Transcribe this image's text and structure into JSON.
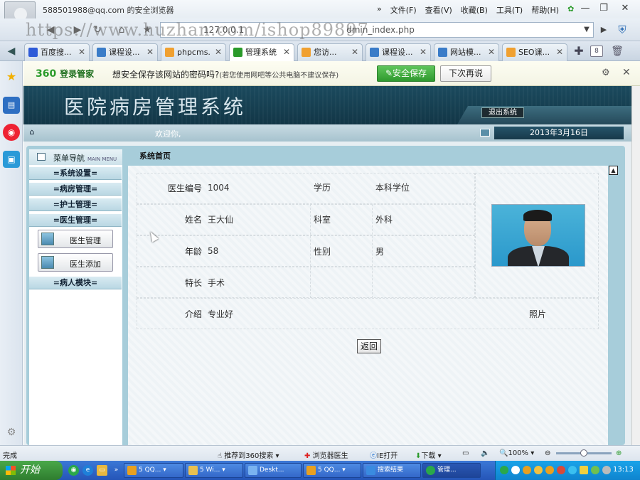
{
  "browser": {
    "title": "588501988@qq.com 的安全浏览器",
    "menu": [
      "文件(F)",
      "查看(V)",
      "收藏(B)",
      "工具(T)",
      "帮助(H)"
    ],
    "window_controls": [
      "—",
      "❐",
      "✕"
    ],
    "address": "127.0.0.1",
    "watermark": "https://www.huzhan.com/ishop89897",
    "address_path": "dmin_index.php",
    "tabs": [
      {
        "label": "百度搜...",
        "active": false
      },
      {
        "label": "课程设...",
        "active": false
      },
      {
        "label": "phpcms...",
        "active": false
      },
      {
        "label": "管理系统",
        "active": true
      },
      {
        "label": "您访...",
        "active": false
      },
      {
        "label": "课程设...",
        "active": false
      },
      {
        "label": "网站模...",
        "active": false
      },
      {
        "label": "SEO课...",
        "active": false
      }
    ],
    "tab_count": "8"
  },
  "password_bar": {
    "logo": "360",
    "logo_sub": "登录管家",
    "message": "想安全保存该网站的密码吗?",
    "hint": "(若您使用网吧等公共电脑不建议保存)",
    "save_label": "安全保存",
    "later_label": "下次再说"
  },
  "page": {
    "system_title": "医院病房管理系统",
    "logout_label": "退出系统",
    "welcome": "欢迎你,",
    "date": "2013年3月16日",
    "menu_title": "菜单导航",
    "menu_title_en": "MAIN MENU",
    "menu": [
      "=系统设置=",
      "=病房管理=",
      "=护士管理=",
      "=医生管理=",
      "=病人模块="
    ],
    "submenu": [
      "医生管理",
      "医生添加"
    ],
    "content_title": "系统首页",
    "detail": {
      "doctor_id_label": "医生编号",
      "doctor_id": "1004",
      "education_label": "学历",
      "education": "本科学位",
      "name_label": "姓名",
      "name": "王大仙",
      "dept_label": "科室",
      "dept": "外科",
      "age_label": "年龄",
      "age": "58",
      "gender_label": "性别",
      "gender": "男",
      "specialty_label": "特长",
      "specialty": "手术",
      "intro_label": "介绍",
      "intro": "专业好",
      "photo_label": "照片"
    },
    "back_label": "返回"
  },
  "statusbar": {
    "status": "完成",
    "recommend": "推荐到360搜索",
    "doctor": "浏览器医生",
    "ie_open": "IE打开",
    "download": "下载",
    "zoom": "100%"
  },
  "taskbar": {
    "start": "开始",
    "tasks": [
      "5 QQ...",
      "5 Wi...",
      "Deskt...",
      "5 QQ...",
      "搜索结果",
      "管理..."
    ],
    "clock": "13:13"
  },
  "colors": {
    "banner": "#1b4a5e",
    "menu_item": "#b9d7e3",
    "save_green": "#2f9a2f",
    "taskbar": "#2555b8"
  }
}
